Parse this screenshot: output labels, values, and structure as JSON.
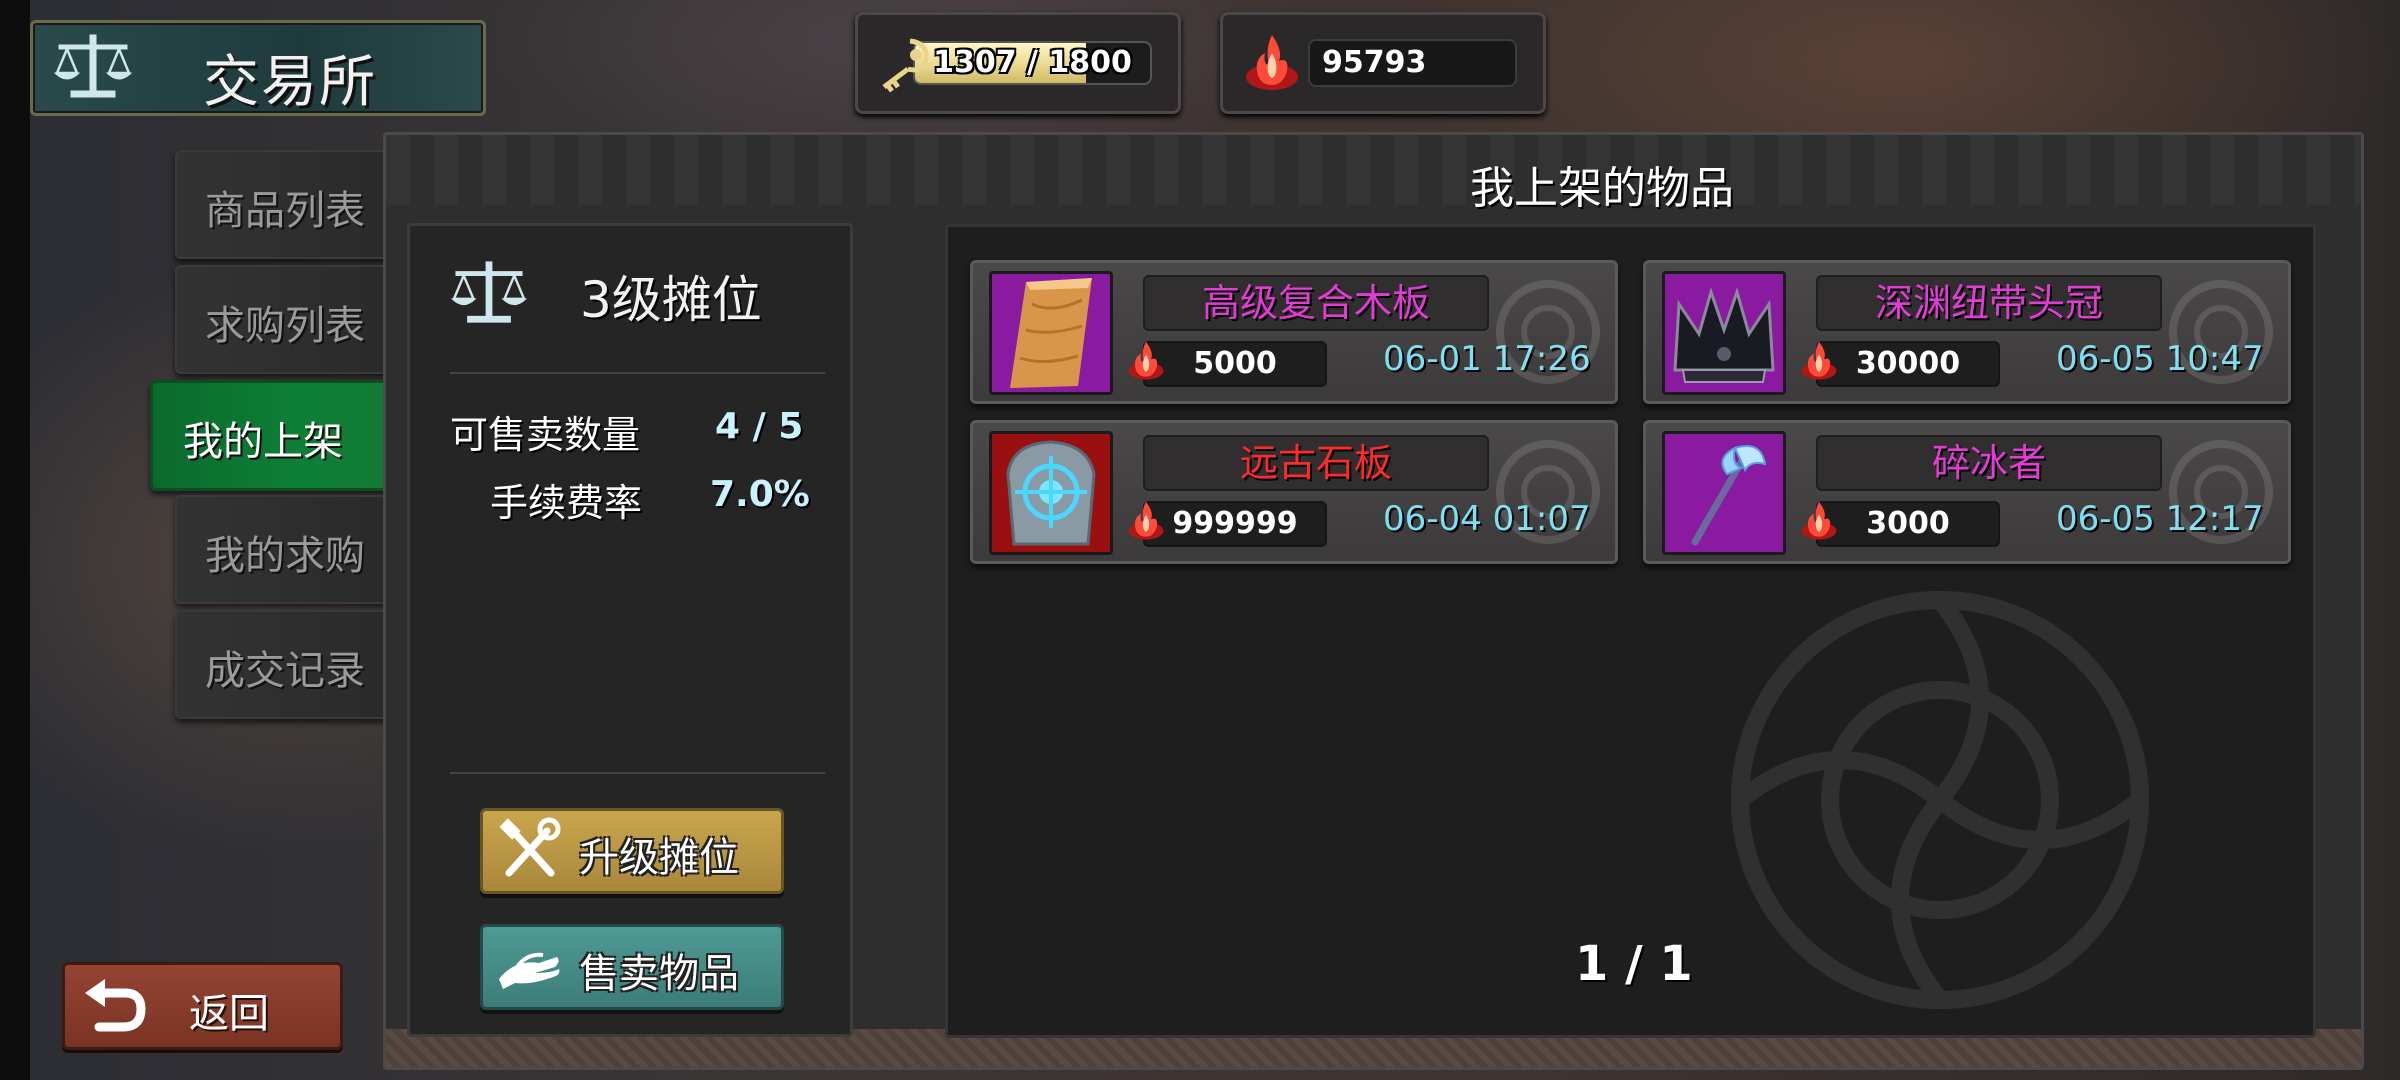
{
  "header": {
    "title": "交易所",
    "stamina": {
      "text": "1307 / 1800",
      "fraction": 0.726
    },
    "gold": "95793"
  },
  "nav": {
    "items": [
      {
        "label": "商品列表",
        "active": false
      },
      {
        "label": "求购列表",
        "active": false
      },
      {
        "label": "我的上架",
        "active": true
      },
      {
        "label": "我的求购",
        "active": false
      },
      {
        "label": "成交记录",
        "active": false
      }
    ],
    "back_label": "返回"
  },
  "stall": {
    "title": "3级摊位",
    "sell_count_label": "可售卖数量",
    "sell_count_value": "4 / 5",
    "fee_label": "手续费率",
    "fee_value": "7.0%",
    "upgrade_label": "升级摊位",
    "sell_label": "售卖物品"
  },
  "listings": {
    "title": "我上架的物品",
    "items": [
      {
        "name": "高级复合木板",
        "price": "5000",
        "time": "06-01 17:26",
        "name_color": "#e23bd6",
        "rarity_color": "#8a1aa0",
        "icon": "wood-plank-icon"
      },
      {
        "name": "深渊纽带头冠",
        "price": "30000",
        "time": "06-05 10:47",
        "name_color": "#e23bd6",
        "rarity_color": "#8a1aa0",
        "icon": "dark-crown-icon"
      },
      {
        "name": "远古石板",
        "price": "999999",
        "time": "06-04 01:07",
        "name_color": "#ff2a2a",
        "rarity_color": "#9a1010",
        "icon": "rune-stone-icon"
      },
      {
        "name": "碎冰者",
        "price": "3000",
        "time": "06-05 12:17",
        "name_color": "#e23bd6",
        "rarity_color": "#8a1aa0",
        "icon": "ice-axe-icon"
      }
    ],
    "page": "1 / 1"
  }
}
